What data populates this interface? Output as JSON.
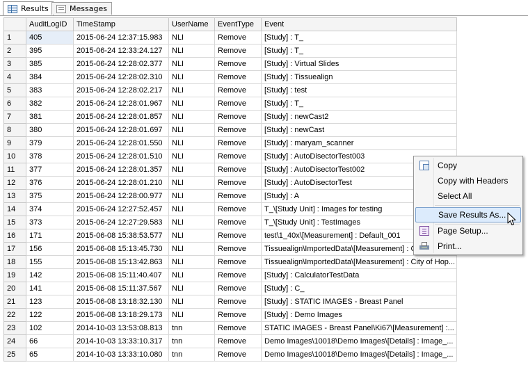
{
  "tabs": [
    {
      "label": "Results",
      "icon": "grid-icon",
      "active": true
    },
    {
      "label": "Messages",
      "icon": "messages-icon",
      "active": false
    }
  ],
  "grid": {
    "columns": [
      "",
      "AuditLogID",
      "TimeStamp",
      "UserName",
      "EventType",
      "Event"
    ],
    "rows": [
      [
        "1",
        "405",
        "2015-06-24 12:37:15.983",
        "NLI",
        "Remove",
        "[Study] : T_"
      ],
      [
        "2",
        "395",
        "2015-06-24 12:33:24.127",
        "NLI",
        "Remove",
        "[Study] : T_"
      ],
      [
        "3",
        "385",
        "2015-06-24 12:28:02.377",
        "NLI",
        "Remove",
        "[Study] : Virtual Slides"
      ],
      [
        "4",
        "384",
        "2015-06-24 12:28:02.310",
        "NLI",
        "Remove",
        "[Study] : Tissuealign"
      ],
      [
        "5",
        "383",
        "2015-06-24 12:28:02.217",
        "NLI",
        "Remove",
        "[Study] : test"
      ],
      [
        "6",
        "382",
        "2015-06-24 12:28:01.967",
        "NLI",
        "Remove",
        "[Study] : T_"
      ],
      [
        "7",
        "381",
        "2015-06-24 12:28:01.857",
        "NLI",
        "Remove",
        "[Study] : newCast2"
      ],
      [
        "8",
        "380",
        "2015-06-24 12:28:01.697",
        "NLI",
        "Remove",
        "[Study] : newCast"
      ],
      [
        "9",
        "379",
        "2015-06-24 12:28:01.550",
        "NLI",
        "Remove",
        "[Study] : maryam_scanner"
      ],
      [
        "10",
        "378",
        "2015-06-24 12:28:01.510",
        "NLI",
        "Remove",
        "[Study] : AutoDisectorTest003"
      ],
      [
        "11",
        "377",
        "2015-06-24 12:28:01.357",
        "NLI",
        "Remove",
        "[Study] : AutoDisectorTest002"
      ],
      [
        "12",
        "376",
        "2015-06-24 12:28:01.210",
        "NLI",
        "Remove",
        "[Study] : AutoDisectorTest"
      ],
      [
        "13",
        "375",
        "2015-06-24 12:28:00.977",
        "NLI",
        "Remove",
        "[Study] : A"
      ],
      [
        "14",
        "374",
        "2015-06-24 12:27:52.457",
        "NLI",
        "Remove",
        "T_\\[Study Unit] : Images for testing"
      ],
      [
        "15",
        "373",
        "2015-06-24 12:27:29.583",
        "NLI",
        "Remove",
        "T_\\[Study Unit] : TestImages"
      ],
      [
        "16",
        "171",
        "2015-06-08 15:38:53.577",
        "NLI",
        "Remove",
        "test\\1_40x\\[Measurement] : Default_001"
      ],
      [
        "17",
        "156",
        "2015-06-08 15:13:45.730",
        "NLI",
        "Remove",
        "Tissuealign\\ImportedData\\[Measurement] : C"
      ],
      [
        "18",
        "155",
        "2015-06-08 15:13:42.863",
        "NLI",
        "Remove",
        "Tissuealign\\ImportedData\\[Measurement] : City of Hop..."
      ],
      [
        "19",
        "142",
        "2015-06-08 15:11:40.407",
        "NLI",
        "Remove",
        "[Study] : CalculatorTestData"
      ],
      [
        "20",
        "141",
        "2015-06-08 15:11:37.567",
        "NLI",
        "Remove",
        "[Study] : C_"
      ],
      [
        "21",
        "123",
        "2015-06-08 13:18:32.130",
        "NLI",
        "Remove",
        "[Study] : STATIC IMAGES - Breast Panel"
      ],
      [
        "22",
        "122",
        "2015-06-08 13:18:29.173",
        "NLI",
        "Remove",
        "[Study] : Demo Images"
      ],
      [
        "23",
        "102",
        "2014-10-03 13:53:08.813",
        "tnn",
        "Remove",
        "STATIC IMAGES - Breast Panel\\Ki67\\[Measurement] :..."
      ],
      [
        "24",
        "66",
        "2014-10-03 13:33:10.317",
        "tnn",
        "Remove",
        "Demo Images\\10018\\Demo Images\\[Details] : Image_..."
      ],
      [
        "25",
        "65",
        "2014-10-03 13:33:10.080",
        "tnn",
        "Remove",
        "Demo Images\\10018\\Demo Images\\[Details] : Image_..."
      ]
    ]
  },
  "context_menu": {
    "items": [
      {
        "label": "Copy",
        "icon": "copy-icon"
      },
      {
        "label": "Copy with Headers",
        "icon": ""
      },
      {
        "label": "Select All",
        "icon": ""
      },
      {
        "label": "Save Results As...",
        "icon": "",
        "highlighted": true
      },
      {
        "label": "Page Setup...",
        "icon": "page-setup-icon"
      },
      {
        "label": "Print...",
        "icon": "printer-icon"
      }
    ]
  },
  "colors": {
    "menu_highlight": "#dcebfc",
    "menu_highlight_border": "#7da2ce",
    "selected_cell": "#e6eef8"
  }
}
